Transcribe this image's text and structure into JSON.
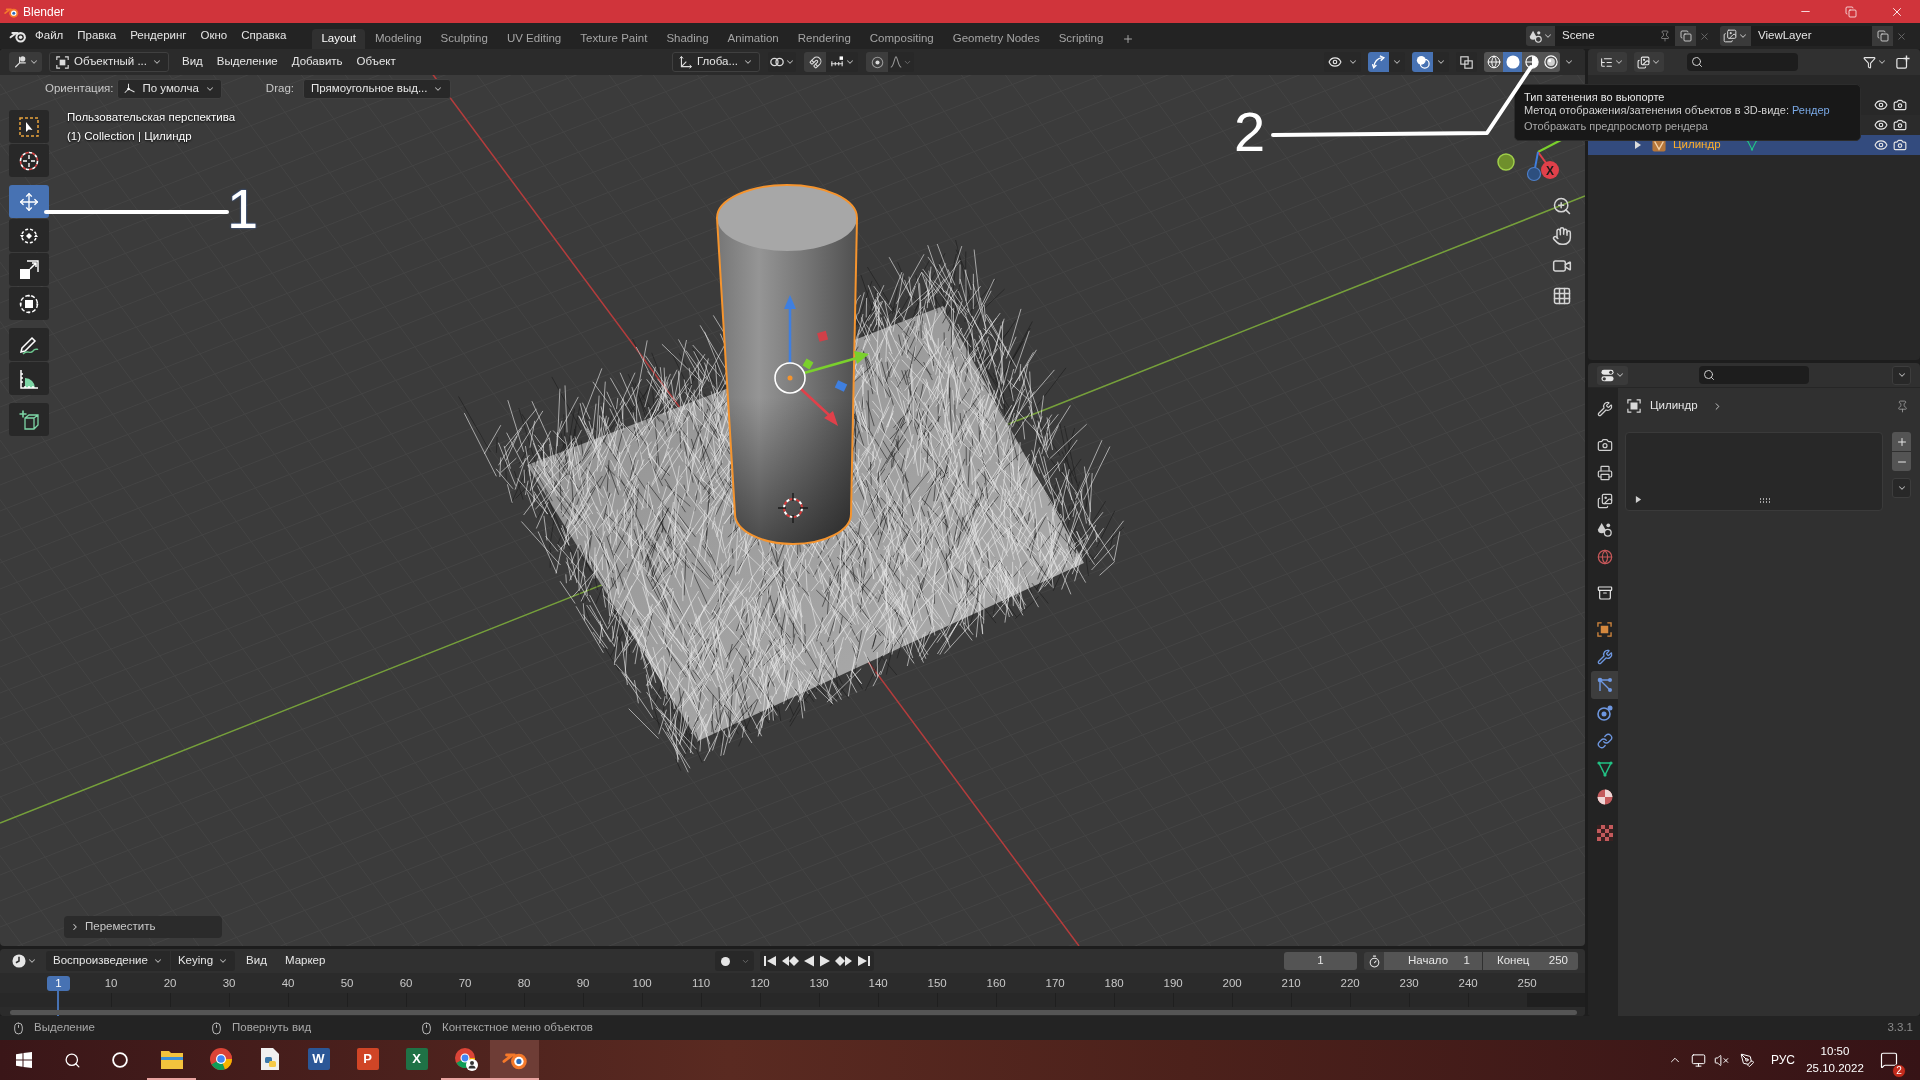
{
  "window": {
    "title": "Blender"
  },
  "menu": [
    "Файл",
    "Правка",
    "Рендеринг",
    "Окно",
    "Справка"
  ],
  "workspaces": [
    {
      "label": "Layout",
      "selected": true
    },
    {
      "label": "Modeling",
      "selected": false
    },
    {
      "label": "Sculpting",
      "selected": false
    },
    {
      "label": "UV Editing",
      "selected": false
    },
    {
      "label": "Texture Paint",
      "selected": false
    },
    {
      "label": "Shading",
      "selected": false
    },
    {
      "label": "Animation",
      "selected": false
    },
    {
      "label": "Rendering",
      "selected": false
    },
    {
      "label": "Compositing",
      "selected": false
    },
    {
      "label": "Geometry Nodes",
      "selected": false
    },
    {
      "label": "Scripting",
      "selected": false
    }
  ],
  "scene_selector": {
    "scene": "Scene",
    "view_layer": "ViewLayer"
  },
  "viewport": {
    "mode": "Объектный ...",
    "menus": [
      "Вид",
      "Выделение",
      "Добавить",
      "Объект"
    ],
    "transform_orientation": "Глоба...",
    "overlay_toggles": [
      {
        "kind": "visibility",
        "on": false
      },
      {
        "kind": "gizmos",
        "on": true
      },
      {
        "kind": "overlays",
        "on": true
      },
      {
        "kind": "xray",
        "on": false
      }
    ],
    "shading": [
      {
        "kind": "wireframe",
        "selected": false
      },
      {
        "kind": "solid",
        "selected": true
      },
      {
        "kind": "material",
        "selected": false
      },
      {
        "kind": "rendered",
        "selected": false
      }
    ],
    "tool_settings": {
      "orientation_label": "Ориентация:",
      "orientation": "По умолча",
      "drag_label": "Drag:",
      "drag": "Прямоугольное выд..."
    },
    "tools": [
      {
        "kind": "select_box",
        "selected": false
      },
      {
        "kind": "cursor",
        "selected": false
      },
      {
        "kind": "move",
        "selected": true
      },
      {
        "kind": "rotate",
        "selected": false
      },
      {
        "kind": "scale",
        "selected": false
      },
      {
        "kind": "transform",
        "selected": false
      },
      {
        "kind": "annotate",
        "selected": false
      },
      {
        "kind": "measure",
        "selected": false
      },
      {
        "kind": "add_cube",
        "selected": false
      }
    ],
    "info": [
      "Пользовательская перспектива",
      "(1) Collection | Цилиндр"
    ],
    "axis_label": "X",
    "last_operator": "Переместить"
  },
  "tooltip": {
    "title": "Тип затенения во вьюпорте",
    "description": "Метод отображения/затенения объектов в 3D-виде:",
    "value": "Рендер",
    "hint": "Отображать предпросмотр рендера"
  },
  "annotations": [
    {
      "label": "1"
    },
    {
      "label": "2"
    }
  ],
  "outliner": {
    "rows": [
      {
        "selected": false
      },
      {
        "selected": false
      },
      {
        "name": "Цилиндр",
        "selected": true,
        "expanded": false
      }
    ]
  },
  "properties": {
    "object": "Цилиндр",
    "tabs": [
      {
        "kind": "tool",
        "selected": false
      },
      {
        "kind": "render",
        "selected": false
      },
      {
        "kind": "output",
        "selected": false
      },
      {
        "kind": "view_layer",
        "selected": false
      },
      {
        "kind": "scene",
        "selected": false
      },
      {
        "kind": "world",
        "selected": false
      },
      {
        "kind": "collection",
        "selected": false
      },
      {
        "kind": "object",
        "selected": false
      },
      {
        "kind": "modifiers",
        "selected": false
      },
      {
        "kind": "particles",
        "selected": true
      },
      {
        "kind": "physics",
        "selected": false
      },
      {
        "kind": "constraints",
        "selected": false
      },
      {
        "kind": "data",
        "selected": false
      },
      {
        "kind": "material",
        "selected": false
      },
      {
        "kind": "texture",
        "selected": false
      }
    ]
  },
  "timeline": {
    "menus": [
      {
        "label": "Воспроизведение",
        "kind": "dropdown"
      },
      {
        "label": "Keying",
        "kind": "dropdown"
      },
      {
        "label": "Вид",
        "kind": "menu"
      },
      {
        "label": "Маркер",
        "kind": "menu"
      }
    ],
    "playhead": "1",
    "ticks": [
      "10",
      "20",
      "30",
      "40",
      "50",
      "60",
      "70",
      "80",
      "90",
      "100",
      "110",
      "120",
      "130",
      "140",
      "150",
      "160",
      "170",
      "180",
      "190",
      "200",
      "210",
      "220",
      "230",
      "240",
      "250"
    ],
    "current_frame": "1",
    "start_label": "Начало",
    "start": "1",
    "end_label": "Конец",
    "end": "250"
  },
  "status_bar": {
    "hints": [
      "Выделение",
      "Повернуть вид",
      "Контекстное меню объектов"
    ],
    "version": "3.3.1"
  },
  "taskbar": {
    "apps": [
      {
        "kind": "explorer",
        "running": true,
        "selected": false
      },
      {
        "kind": "chrome",
        "running": false,
        "selected": false
      },
      {
        "kind": "python_file",
        "running": false,
        "selected": false
      },
      {
        "kind": "word",
        "letter": "W",
        "running": false,
        "selected": false
      },
      {
        "kind": "powerpoint",
        "letter": "P",
        "running": false,
        "selected": false
      },
      {
        "kind": "excel",
        "letter": "X",
        "running": false,
        "selected": false
      },
      {
        "kind": "chrome_profile",
        "running": true,
        "selected": false
      },
      {
        "kind": "blender",
        "running": true,
        "selected": true
      }
    ],
    "language": "РУС",
    "time": "10:50",
    "date": "25.10.2022",
    "notifications": "2"
  }
}
